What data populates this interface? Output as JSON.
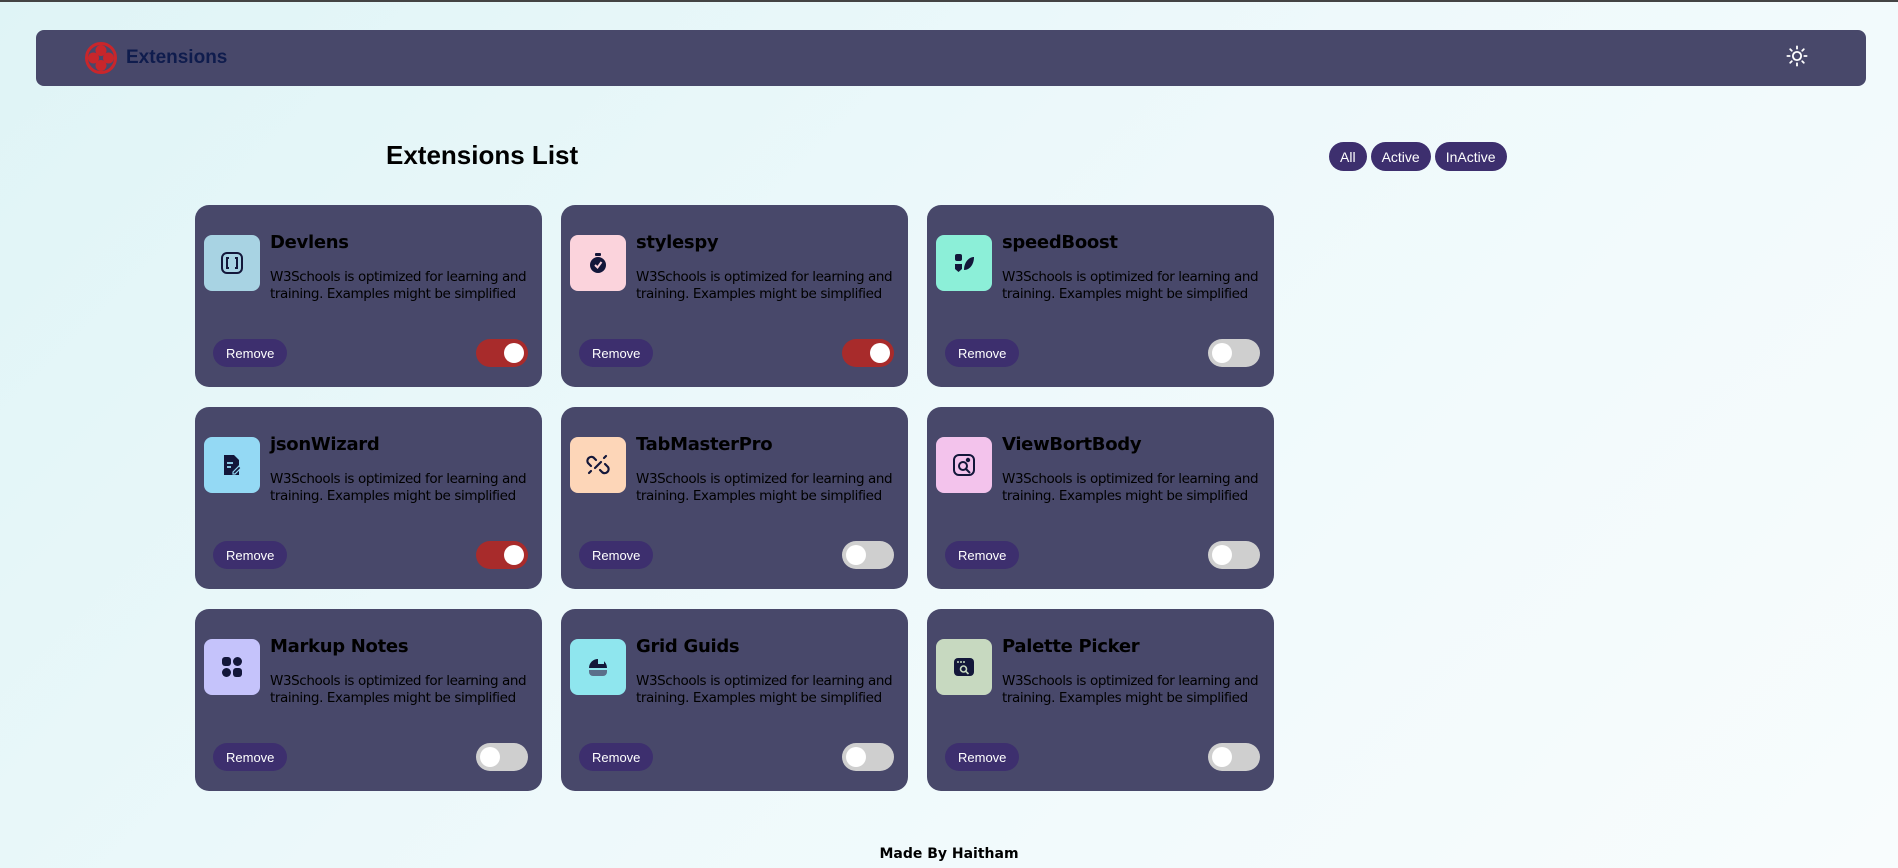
{
  "header": {
    "brand_title": "Extensions",
    "logo_icon": "red-circle-logo-icon",
    "theme_icon": "sun-icon",
    "accent_color": "#a82b2b"
  },
  "main": {
    "title": "Extensions List",
    "filters": [
      "All",
      "Active",
      "InActive"
    ]
  },
  "extensions": [
    {
      "name": "Devlens",
      "description": "W3Schools is optimized for learning and training. Examples might be simplified",
      "remove_label": "Remove",
      "active": true,
      "icon": "brackets-icon",
      "icon_bg": "#a8d3e3"
    },
    {
      "name": "stylespy",
      "description": "W3Schools is optimized for learning and training. Examples might be simplified",
      "remove_label": "Remove",
      "active": true,
      "icon": "stopwatch-icon",
      "icon_bg": "#fbd3dc"
    },
    {
      "name": "speedBoost",
      "description": "W3Schools is optimized for learning and training. Examples might be simplified",
      "remove_label": "Remove",
      "active": false,
      "icon": "leaf-badge-icon",
      "icon_bg": "#8cefd8"
    },
    {
      "name": "jsonWizard",
      "description": "W3Schools is optimized for learning and training. Examples might be simplified",
      "remove_label": "Remove",
      "active": true,
      "icon": "document-edit-icon",
      "icon_bg": "#94d9f4"
    },
    {
      "name": "TabMasterPro",
      "description": "W3Schools is optimized for learning and training. Examples might be simplified",
      "remove_label": "Remove",
      "active": false,
      "icon": "link-icon",
      "icon_bg": "#fdd6b8"
    },
    {
      "name": "ViewBortBody",
      "description": "W3Schools is optimized for learning and training. Examples might be simplified",
      "remove_label": "Remove",
      "active": false,
      "icon": "image-search-icon",
      "icon_bg": "#f3c3ec"
    },
    {
      "name": "Markup Notes",
      "description": "W3Schools is optimized for learning and training. Examples might be simplified",
      "remove_label": "Remove",
      "active": false,
      "icon": "grid-dots-icon",
      "icon_bg": "#c5c3fb"
    },
    {
      "name": "Grid Guids",
      "description": "W3Schools is optimized for learning and training. Examples might be simplified",
      "remove_label": "Remove",
      "active": false,
      "icon": "cap-icon",
      "icon_bg": "#8fe6ee"
    },
    {
      "name": "Palette Picker",
      "description": "W3Schools is optimized for learning and training. Examples might be simplified",
      "remove_label": "Remove",
      "active": false,
      "icon": "browser-search-icon",
      "icon_bg": "#c7d9c0"
    }
  ],
  "footer": {
    "text": "Made By Haitham"
  }
}
